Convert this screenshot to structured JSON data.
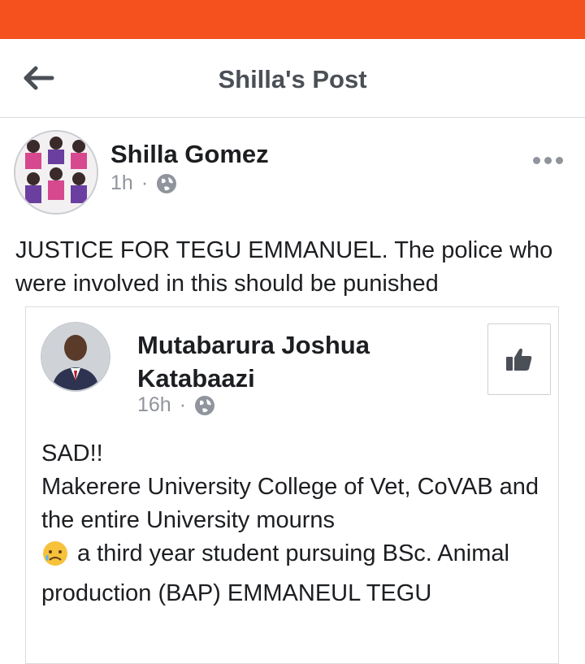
{
  "header": {
    "title": "Shilla's Post",
    "back_icon": "arrow-left-icon"
  },
  "post": {
    "author": "Shilla Gomez",
    "time": "1h",
    "separator": "·",
    "privacy_icon": "globe-icon",
    "more_icon": "more-horizontal-icon",
    "text": "JUSTICE FOR TEGU EMMANUEL. The police who were involved in this should be punished"
  },
  "shared_post": {
    "author": "Mutabarura Joshua Katabaazi",
    "time": "16h",
    "separator": "·",
    "privacy_icon": "globe-icon",
    "like_icon": "thumbs-up-icon",
    "body": {
      "line1": "SAD!!",
      "line2": "Makerere University College of Vet, CoVAB and the entire University  mourns",
      "emoji": "sad-face-emoji",
      "line3": "a third year student pursuing BSc. Animal production (BAP) EMMANEUL TEGU"
    }
  },
  "colors": {
    "status_bar": "#f4511e",
    "title_text": "#4b4f56",
    "meta_text": "#90949c",
    "body_text": "#1c1e21",
    "divider": "#dadde1"
  }
}
